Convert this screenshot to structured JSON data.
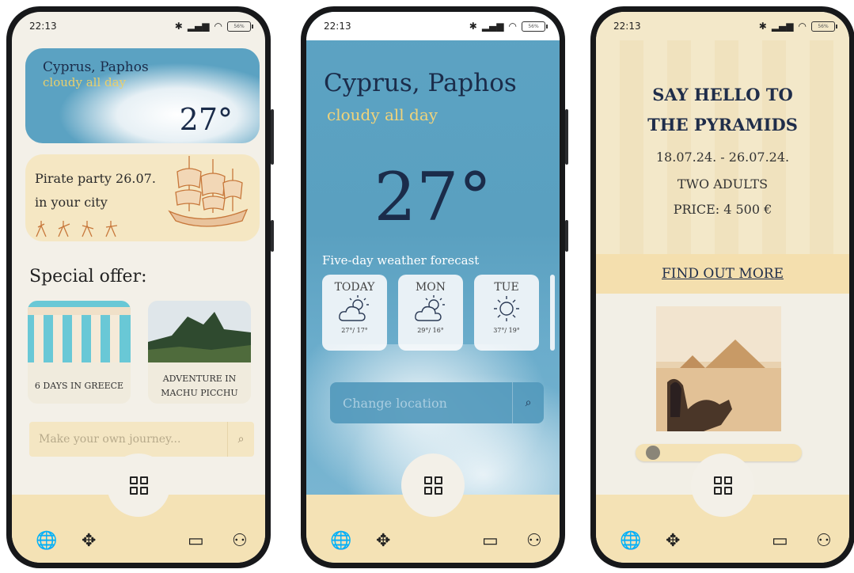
{
  "status": {
    "time": "22:13",
    "battery": "56%"
  },
  "screen1": {
    "weather": {
      "city": "Cyprus, Paphos",
      "condition": "cloudy all day",
      "temp": "27°"
    },
    "event": {
      "line1": "Pirate party 26.07.",
      "line2": "in your city"
    },
    "special_title": "Special offer:",
    "offers": [
      {
        "label": "6 DAYS IN GREECE"
      },
      {
        "label": "ADVENTURE IN MACHU PICCHU"
      }
    ],
    "journey_placeholder": "Make your own journey..."
  },
  "screen2": {
    "city": "Cyprus, Paphos",
    "condition": "cloudy all day",
    "temp": "27°",
    "forecast_title": "Five-day weather forecast",
    "forecast": [
      {
        "day": "TODAY",
        "icon": "partly-cloudy-icon",
        "range": "27°/ 17°"
      },
      {
        "day": "MON",
        "icon": "partly-cloudy-icon",
        "range": "29°/ 16°"
      },
      {
        "day": "TUE",
        "icon": "sun-icon",
        "range": "37°/ 19°"
      }
    ],
    "location_placeholder": "Change location"
  },
  "screen3": {
    "title_line1": "SAY HELLO TO",
    "title_line2": "THE PYRAMIDS",
    "dates": "18.07.24. - 26.07.24.",
    "people": "TWO ADULTS",
    "price": "PRICE: 4 500 €",
    "cta": "FIND OUT MORE",
    "slider_position": 0.05
  },
  "nav": {
    "items": [
      "globe-plane-icon",
      "move-arrows-icon",
      "grid-menu-icon",
      "ticket-icon",
      "user-icon"
    ]
  },
  "colors": {
    "sky_blue": "#5ba2c2",
    "cream": "#f4e2b5",
    "navy_text": "#1b2c4a",
    "yellow_text": "#e9cf6c"
  }
}
